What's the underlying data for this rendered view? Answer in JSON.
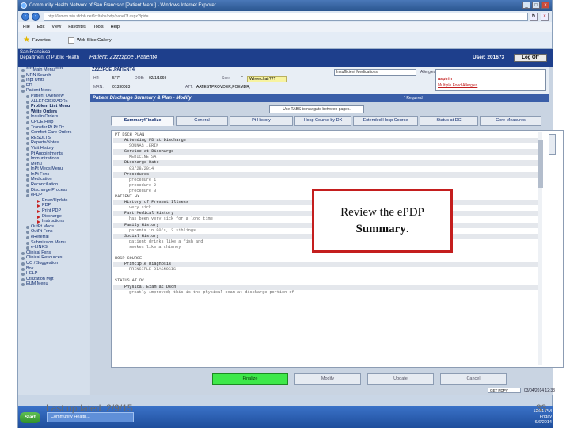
{
  "browser": {
    "title": "Community Health Network of San Francisco [Patient Menu] - Windows Internet Explorer",
    "url": "http://lemon.win.sfdph.net/lcr/tabs/pdp/paneOf.aspx?lpid=...",
    "menu": [
      "File",
      "Edit",
      "View",
      "Favorites",
      "Tools",
      "Help"
    ],
    "favorites_label": "Favorites",
    "web_slice_label": "Web Slice Gallery"
  },
  "app": {
    "org_line1": "San Francisco",
    "org_line2": "Department of Public Health",
    "patient_label": "Patient: Zzzzzpoe ,Patient4",
    "user_label": "User: 201673",
    "logoff_label": "Log Off"
  },
  "nav": [
    {
      "label": "****Main Menu*****",
      "level": 0,
      "bold": false
    },
    {
      "label": "MRN Search",
      "level": 0,
      "bold": false
    },
    {
      "label": "Inpt Units",
      "level": 0,
      "bold": false
    },
    {
      "label": "ED",
      "level": 0,
      "bold": false
    },
    {
      "label": "Patient Menu",
      "level": 0,
      "bold": false
    },
    {
      "label": "Patient Overview",
      "level": 1,
      "bold": false
    },
    {
      "label": "ALLERGIES/ADRs",
      "level": 1,
      "bold": false
    },
    {
      "label": "Problem List Menu",
      "level": 1,
      "bold": true
    },
    {
      "label": "Write Orders",
      "level": 1,
      "bold": true
    },
    {
      "label": "Insulin Orders",
      "level": 1,
      "bold": false
    },
    {
      "label": "CPOE Help",
      "level": 1,
      "bold": false
    },
    {
      "label": "Transfer Pt Pt Dx",
      "level": 1,
      "bold": false
    },
    {
      "label": "Comfort Care Orders",
      "level": 1,
      "bold": false
    },
    {
      "label": "RESULTS",
      "level": 1,
      "bold": false
    },
    {
      "label": "Reports/Notes",
      "level": 1,
      "bold": false
    },
    {
      "label": "Visit History",
      "level": 1,
      "bold": false
    },
    {
      "label": "Pt Appointments",
      "level": 1,
      "bold": false
    },
    {
      "label": "Immunizations",
      "level": 1,
      "bold": false
    },
    {
      "label": "Menu",
      "level": 1,
      "bold": false
    },
    {
      "label": "InPt Meds Menu",
      "level": 1,
      "bold": false
    },
    {
      "label": "InPt Fxns",
      "level": 1,
      "bold": false
    },
    {
      "label": "Medication",
      "level": 1,
      "bold": false
    },
    {
      "label": "Reconciliation",
      "level": 1,
      "bold": false
    },
    {
      "label": "Discharge Process",
      "level": 1,
      "bold": false
    },
    {
      "label": "ePDP",
      "level": 1,
      "bold": false
    },
    {
      "label": "Enter/Update",
      "level": 2,
      "bold": false
    },
    {
      "label": "PDP",
      "level": 2,
      "bold": false
    },
    {
      "label": "Print PDP",
      "level": 2,
      "bold": false
    },
    {
      "label": "Discharge",
      "level": 2,
      "bold": false
    },
    {
      "label": "Instructions",
      "level": 2,
      "bold": false
    },
    {
      "label": "OutPt Meds",
      "level": 1,
      "bold": false
    },
    {
      "label": "OutPt Fxns",
      "level": 1,
      "bold": false
    },
    {
      "label": "eReferral",
      "level": 1,
      "bold": false
    },
    {
      "label": "Submission Menu",
      "level": 1,
      "bold": false
    },
    {
      "label": "e-LINKS",
      "level": 1,
      "bold": false
    },
    {
      "label": "Clinical Fxns",
      "level": 0,
      "bold": false
    },
    {
      "label": "Clinical Resources",
      "level": 0,
      "bold": false
    },
    {
      "label": "UO / Suggestion",
      "level": 0,
      "bold": false
    },
    {
      "label": "Box",
      "level": 0,
      "bold": false
    },
    {
      "label": "HELP",
      "level": 0,
      "bold": false
    },
    {
      "label": "Utilization Mgt",
      "level": 0,
      "bold": false
    },
    {
      "label": "EUM Menu",
      "level": 0,
      "bold": false
    }
  ],
  "patient_info": {
    "name": "ZZZZPOE ,PATIENT4",
    "ht_label": "HT:",
    "ht_value": "5' 7\"",
    "dob_label": "DOB:",
    "dob_value": "02/1/1969",
    "sex_label": "Sex:",
    "sex_value": "F",
    "mrn_label": "MRN:",
    "mrn_value": "01330083",
    "att_label": "ATT:",
    "att_value": "AATESTPROVDER,PCEMDR;",
    "wheelchair": "Wheelchair???",
    "insufficient_label": "Insufficient Medications:",
    "allergies_label": "Allergies:",
    "allergy_1": "aspirin",
    "more_allergies": "Multiple Food Allergies"
  },
  "form": {
    "title": "Patient Discharge Summary & Plan - Modify",
    "required": "* Required",
    "tab_hint": "Use TABS to navigate between pages."
  },
  "tabs": [
    {
      "label": "Summary/Finalize",
      "active": true
    },
    {
      "label": "General",
      "active": false
    },
    {
      "label": "Pt History",
      "active": false
    },
    {
      "label": "Hosp Course by DX",
      "active": false
    },
    {
      "label": "Extended Hosp Course",
      "active": false
    },
    {
      "label": "Status at DC",
      "active": false
    },
    {
      "label": "Core Measures",
      "active": false
    }
  ],
  "document": [
    {
      "text": "PT DSCH PLAN",
      "style": "sec"
    },
    {
      "text": "Attending PD at Discharge",
      "style": "l1 shade"
    },
    {
      "text": "SOUNAS ,ERIN",
      "style": "l2"
    },
    {
      "text": "Service at Discharge",
      "style": "l1 shade"
    },
    {
      "text": "MEDICINE SA",
      "style": "l2"
    },
    {
      "text": "Discharge Date",
      "style": "l1 shade"
    },
    {
      "text": "03/28/2014",
      "style": "l2"
    },
    {
      "text": "Procedures",
      "style": "l1 shade"
    },
    {
      "text": "procedure 1",
      "style": "l2"
    },
    {
      "text": "procedure 2",
      "style": "l2"
    },
    {
      "text": "procedure 3",
      "style": "l2"
    },
    {
      "text": "PATIENT HX",
      "style": "sec"
    },
    {
      "text": "History of Present Illness",
      "style": "l1 shade"
    },
    {
      "text": "very sick",
      "style": "l2"
    },
    {
      "text": "Past Medical History",
      "style": "l1 shade"
    },
    {
      "text": "has been very sick for a long time",
      "style": "l2"
    },
    {
      "text": "Family History",
      "style": "l1 shade"
    },
    {
      "text": "parents in 80's, 3 siblings",
      "style": "l2"
    },
    {
      "text": "Social History",
      "style": "l1 shade"
    },
    {
      "text": "patient drinks like a fish and",
      "style": "l2"
    },
    {
      "text": "smokes like a chimney",
      "style": "l2"
    },
    {
      "text": "",
      "style": "l2"
    },
    {
      "text": "HOSP COURSE",
      "style": "sec"
    },
    {
      "text": "Principle Diagnosis",
      "style": "l1 shade"
    },
    {
      "text": "PRINCIPLE DIAGNOSIS",
      "style": "l2"
    },
    {
      "text": "",
      "style": "l2"
    },
    {
      "text": "STATUS AT DC",
      "style": "sec"
    },
    {
      "text": "Physical Exam at Dsch",
      "style": "l1 shade"
    },
    {
      "text": "greatly improved; this is the physical exam at discharge portion of",
      "style": "l2"
    }
  ],
  "actions": {
    "finalize": "Finalize",
    "modify": "Modify",
    "update": "Update",
    "cancel": "Cancel",
    "datetime": "03/04/2014 12:33",
    "pdp_version": "GET PDPV"
  },
  "overlay": {
    "line1": "Review the ePDP",
    "line2": "Summary",
    "punct": "."
  },
  "taskbar": {
    "start": "Start",
    "task_app": "Community Health...",
    "clock_time": "12:51 PM",
    "clock_day": "Friday",
    "clock_date": "6/6/2014"
  },
  "footer": {
    "last_updated": "Last updated: 2/9/15",
    "page_number": "33"
  }
}
